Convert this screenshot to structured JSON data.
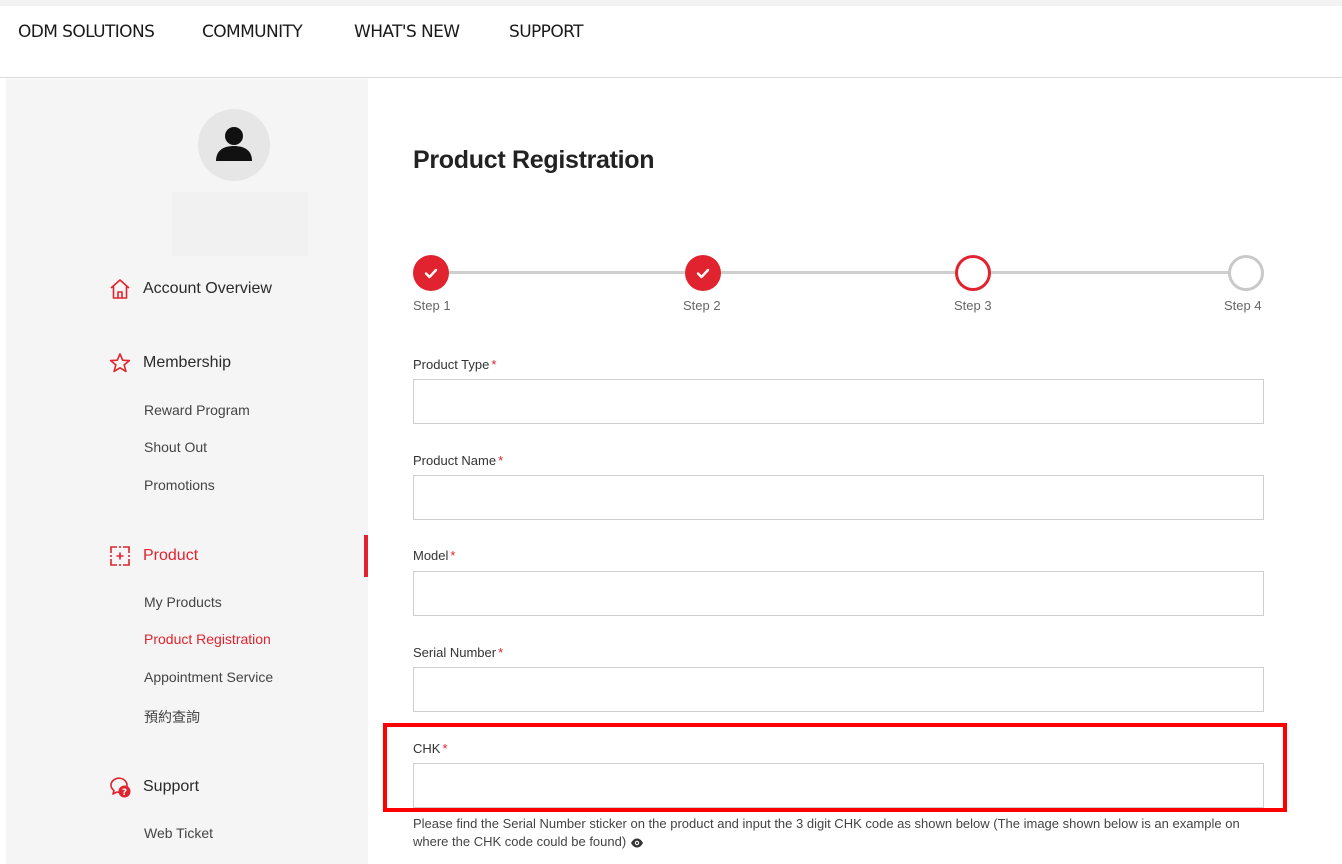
{
  "nav": {
    "items": [
      {
        "label": "ODM SOLUTIONS"
      },
      {
        "label": "COMMUNITY"
      },
      {
        "label": "WHAT'S NEW"
      },
      {
        "label": "SUPPORT"
      }
    ]
  },
  "sidebar": {
    "account_overview": "Account Overview",
    "membership": {
      "label": "Membership",
      "items": [
        "Reward Program",
        "Shout Out",
        "Promotions"
      ]
    },
    "product": {
      "label": "Product",
      "items": [
        "My Products",
        "Product Registration",
        "Appointment Service",
        "預約查詢"
      ],
      "active_item": "Product Registration"
    },
    "support": {
      "label": "Support",
      "items": [
        "Web Ticket"
      ]
    },
    "icons": {
      "account_overview": "home-icon",
      "membership": "star-icon",
      "product": "product-frame-icon",
      "support": "support-chat-icon",
      "avatar": "user-icon"
    }
  },
  "main": {
    "title": "Product Registration",
    "steps": [
      {
        "label": "Step 1",
        "status": "done"
      },
      {
        "label": "Step 2",
        "status": "done"
      },
      {
        "label": "Step 3",
        "status": "current"
      },
      {
        "label": "Step 4",
        "status": "todo"
      }
    ],
    "form": {
      "product_type": {
        "label": "Product Type",
        "value": ""
      },
      "product_name": {
        "label": "Product Name",
        "value": ""
      },
      "model": {
        "label": "Model",
        "value": ""
      },
      "serial_number": {
        "label": "Serial Number",
        "value": ""
      },
      "chk": {
        "label": "CHK",
        "value": ""
      },
      "required_mark": "*"
    },
    "chk_help": "Please find the Serial Number sticker on the product and input the 3 digit CHK code as shown below (The image shown below is an example on where the CHK code could be found)"
  },
  "colors": {
    "accent": "#e0232e",
    "highlight": "#ff0000"
  }
}
